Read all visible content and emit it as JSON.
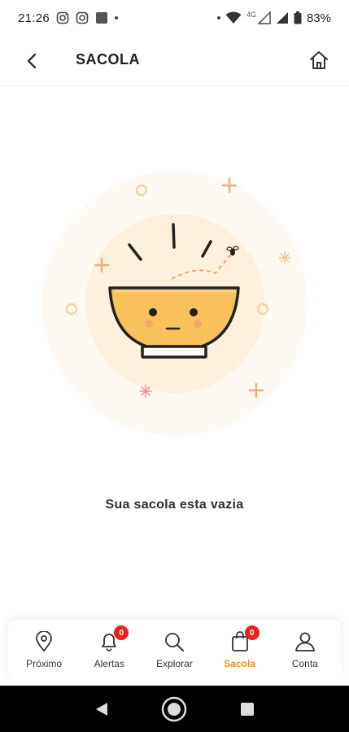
{
  "status_bar": {
    "time": "21:26",
    "network": "4G",
    "battery": "83%",
    "left_icons": [
      "instagram-icon",
      "instagram-icon",
      "square-app-icon",
      "dot"
    ],
    "right_icons": [
      "dot",
      "wifi-icon",
      "signal-icon",
      "signal-icon",
      "battery-icon"
    ]
  },
  "header": {
    "title": "SACOLA",
    "back_icon": "chevron-left-icon",
    "home_icon": "home-icon"
  },
  "empty_state": {
    "message": "Sua sacola esta vazia",
    "illustration": "empty-bowl"
  },
  "bottom_nav": {
    "items": [
      {
        "label": "Próximo",
        "icon": "map-pin-icon",
        "badge": null,
        "active": false
      },
      {
        "label": "Alertas",
        "icon": "bell-icon",
        "badge": "0",
        "active": false
      },
      {
        "label": "Explorar",
        "icon": "search-icon",
        "badge": null,
        "active": false
      },
      {
        "label": "Sacola",
        "icon": "bag-icon",
        "badge": "0",
        "active": true
      },
      {
        "label": "Conta",
        "icon": "user-icon",
        "badge": null,
        "active": false
      }
    ]
  },
  "colors": {
    "accent": "#f28c1e",
    "badge": "#e8231e",
    "bowl": "#f8c15c",
    "halo": "#fdf3e4"
  }
}
